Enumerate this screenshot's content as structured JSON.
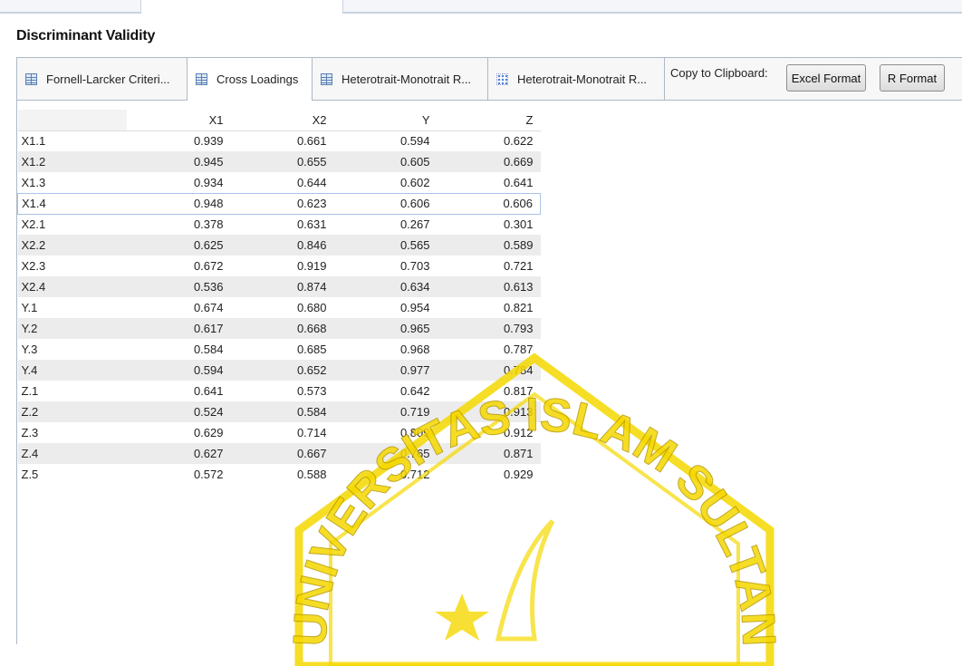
{
  "title": "Discriminant Validity",
  "tabs": [
    {
      "label": "Fornell-Larcker Criteri...",
      "icon": "table-icon",
      "active": false
    },
    {
      "label": "Cross Loadings",
      "icon": "table-icon",
      "active": true
    },
    {
      "label": "Heterotrait-Monotrait R...",
      "icon": "table-icon",
      "active": false
    },
    {
      "label": "Heterotrait-Monotrait R...",
      "icon": "matrix-chart-icon",
      "active": false
    }
  ],
  "clipboard": {
    "label": "Copy to Clipboard:",
    "excel_button": "Excel Format",
    "r_button": "R Format"
  },
  "table": {
    "columns": [
      "X1",
      "X2",
      "Y",
      "Z"
    ],
    "rows": [
      {
        "label": "X1.1",
        "values": [
          "0.939",
          "0.661",
          "0.594",
          "0.622"
        ]
      },
      {
        "label": "X1.2",
        "values": [
          "0.945",
          "0.655",
          "0.605",
          "0.669"
        ]
      },
      {
        "label": "X1.3",
        "values": [
          "0.934",
          "0.644",
          "0.602",
          "0.641"
        ]
      },
      {
        "label": "X1.4",
        "values": [
          "0.948",
          "0.623",
          "0.606",
          "0.606"
        ],
        "selected": true
      },
      {
        "label": "X2.1",
        "values": [
          "0.378",
          "0.631",
          "0.267",
          "0.301"
        ]
      },
      {
        "label": "X2.2",
        "values": [
          "0.625",
          "0.846",
          "0.565",
          "0.589"
        ]
      },
      {
        "label": "X2.3",
        "values": [
          "0.672",
          "0.919",
          "0.703",
          "0.721"
        ]
      },
      {
        "label": "X2.4",
        "values": [
          "0.536",
          "0.874",
          "0.634",
          "0.613"
        ]
      },
      {
        "label": "Y.1",
        "values": [
          "0.674",
          "0.680",
          "0.954",
          "0.821"
        ]
      },
      {
        "label": "Y.2",
        "values": [
          "0.617",
          "0.668",
          "0.965",
          "0.793"
        ]
      },
      {
        "label": "Y.3",
        "values": [
          "0.584",
          "0.685",
          "0.968",
          "0.787"
        ]
      },
      {
        "label": "Y.4",
        "values": [
          "0.594",
          "0.652",
          "0.977",
          "0.784"
        ]
      },
      {
        "label": "Z.1",
        "values": [
          "0.641",
          "0.573",
          "0.642",
          "0.817"
        ]
      },
      {
        "label": "Z.2",
        "values": [
          "0.524",
          "0.584",
          "0.719",
          "0.913"
        ]
      },
      {
        "label": "Z.3",
        "values": [
          "0.629",
          "0.714",
          "0.809",
          "0.912"
        ]
      },
      {
        "label": "Z.4",
        "values": [
          "0.627",
          "0.667",
          "0.765",
          "0.871"
        ]
      },
      {
        "label": "Z.5",
        "values": [
          "0.572",
          "0.588",
          "0.712",
          "0.929"
        ]
      }
    ]
  },
  "watermark": {
    "text": "UNIVERSITAS ISLAM SULTAN",
    "color": "#f5d800"
  }
}
